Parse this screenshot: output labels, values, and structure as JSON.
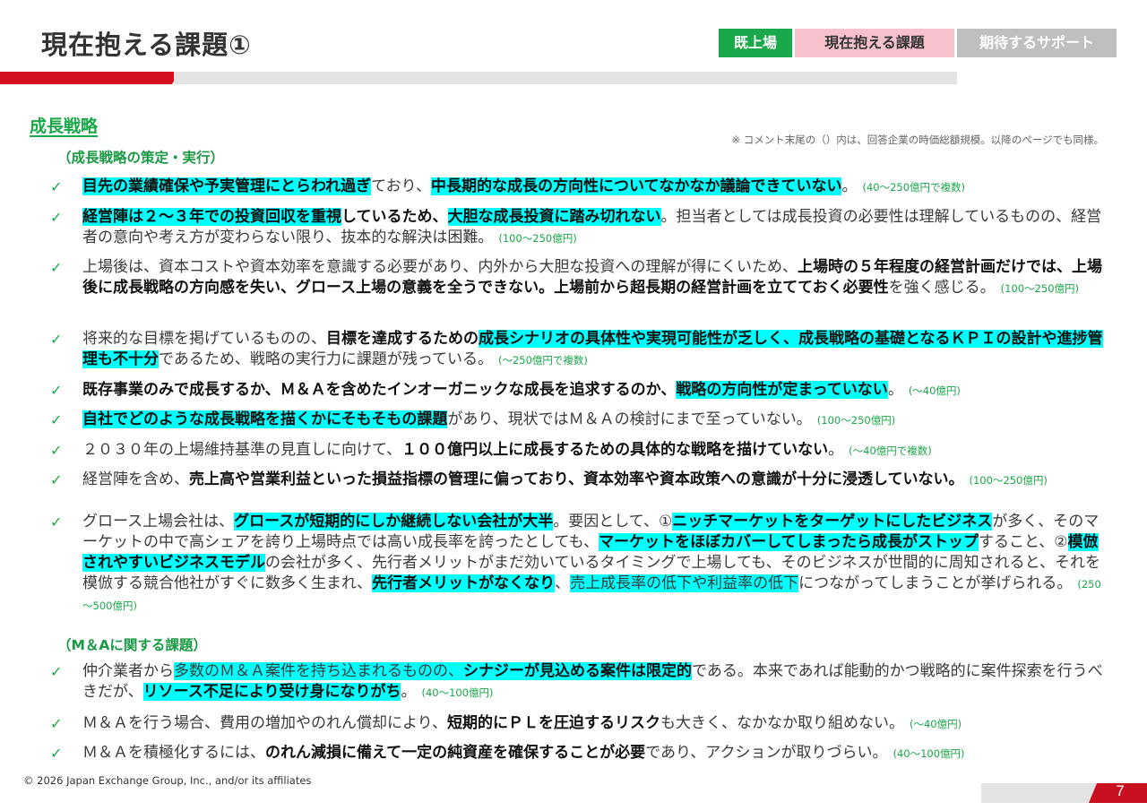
{
  "header": {
    "title": "現在抱える課題①",
    "tabs": [
      "既上場",
      "現在抱える課題",
      "期待するサポート"
    ]
  },
  "colors": {
    "accent_green": "#1aa84a",
    "accent_red": "#d2101e",
    "highlight": "#00ffff",
    "tab_active_pink": "#f7c1ce",
    "tab_inactive_gray": "#bfbfbf"
  },
  "section": {
    "title": "成長戦略",
    "note": "※ コメント末尾の（）内は、回答企業の時価総額規模。以降のページでも同様。"
  },
  "subsections": [
    "（成長戦略の策定・実行）",
    "（M＆Aに関する課題）"
  ],
  "check_mark": "✓",
  "items": [
    {
      "segs": [
        {
          "t": "目先の業績確保や予実管理にとらわれ過ぎ",
          "s": "bh"
        },
        {
          "t": "ており、",
          "s": "n"
        },
        {
          "t": "中長期的な成長の方向性についてなかなか議論できていない",
          "s": "bh"
        },
        {
          "t": "。",
          "s": "n"
        }
      ],
      "size": "(40～250億円で複数)"
    },
    {
      "segs": [
        {
          "t": "経営陣は２～３年での投資回収を重視",
          "s": "bh"
        },
        {
          "t": "しているため、",
          "s": "b"
        },
        {
          "t": "大胆な成長投資に踏み切れない",
          "s": "bh"
        },
        {
          "t": "。担当者としては成長投資の必要性は理解しているものの、経営者の意向や考え方が変わらない限り、抜本的な解決は困難。",
          "s": "n"
        }
      ],
      "size": "(100～250億円)"
    },
    {
      "segs": [
        {
          "t": "上場後は、資本コストや資本効率を意識する必要があり、内外から大胆な投資への理解が得にくいため、",
          "s": "n"
        },
        {
          "t": "上場時の５年程度の経営計画だけでは、上場後に成長戦略の方向感を失い、グロース上場の意義を全うできない。上場前から超長期の経営計画を立てておく必要性",
          "s": "b"
        },
        {
          "t": "を強く感じる。",
          "s": "n"
        }
      ],
      "size": "(100～250億円)"
    },
    {
      "segs": [
        {
          "t": "将来的な目標を掲げているものの、",
          "s": "n"
        },
        {
          "t": "目標を達成するための",
          "s": "b"
        },
        {
          "t": "成長シナリオの具体性や実現可能性が乏しく、成長戦略の基礎となるＫＰＩの設計や進捗管理も不十分",
          "s": "bh"
        },
        {
          "t": "であるため、戦略の実行力に課題が残っている。",
          "s": "n"
        }
      ],
      "size": "(～250億円で複数)"
    },
    {
      "segs": [
        {
          "t": "既存事業のみで成長するか、Ｍ＆Ａを含めたインオーガニックな成長を追求するのか、",
          "s": "b"
        },
        {
          "t": "戦略の方向性が定まっていない",
          "s": "bh"
        },
        {
          "t": "。",
          "s": "n"
        }
      ],
      "size": "(～40億円)"
    },
    {
      "segs": [
        {
          "t": "自社でどのような成長戦略を描くかにそもそもの課題",
          "s": "bh"
        },
        {
          "t": "があり、現状ではＭ＆Ａの検討にまで至っていない。",
          "s": "n"
        }
      ],
      "size": "(100～250億円)"
    },
    {
      "segs": [
        {
          "t": "２０３０年の上場維持基準の見直しに向けて、",
          "s": "n"
        },
        {
          "t": "１００億円以上に成長するための具体的な戦略を描けていない",
          "s": "b"
        },
        {
          "t": "。",
          "s": "n"
        }
      ],
      "size": "(～40億円で複数)"
    },
    {
      "segs": [
        {
          "t": "経営陣を含め、",
          "s": "n"
        },
        {
          "t": "売上高や営業利益といった損益指標の管理に偏っており、資本効率や資本政策への意識が十分に浸透していない。",
          "s": "b"
        }
      ],
      "size": "(100～250億円)"
    },
    {
      "segs": [
        {
          "t": "グロース上場会社は、",
          "s": "n"
        },
        {
          "t": "グロースが短期的にしか継続しない会社が大半",
          "s": "bh"
        },
        {
          "t": "。要因として、①",
          "s": "n"
        },
        {
          "t": "ニッチマーケットをターゲットにしたビジネス",
          "s": "bh"
        },
        {
          "t": "が多く、そのマーケットの中で高シェアを誇り上場時点では高い成長率を誇ったとしても、",
          "s": "n"
        },
        {
          "t": "マーケットをほぼカバーしてしまったら成長がストップ",
          "s": "bh"
        },
        {
          "t": "すること、②",
          "s": "n"
        },
        {
          "t": "模倣されやすいビジネスモデル",
          "s": "bh"
        },
        {
          "t": "の会社が多く、先行者メリットがまだ効いているタイミングで上場しても、そのビジネスが世間的に周知されると、それを模倣する競合他社がすぐに数多く生まれ、",
          "s": "n"
        },
        {
          "t": "先行者メリットがなくなり",
          "s": "bh"
        },
        {
          "t": "、",
          "s": "n"
        },
        {
          "t": "売上成長率の低下や利益率の低下",
          "s": "h"
        },
        {
          "t": "につながってしまうことが挙げられる。",
          "s": "n"
        }
      ],
      "size": "(250～500億円)"
    },
    {
      "segs": [
        {
          "t": "仲介業者から",
          "s": "n"
        },
        {
          "t": "多数のＭ＆Ａ案件を持ち込まれるものの、",
          "s": "h"
        },
        {
          "t": "シナジーが見込める案件は限定的",
          "s": "bh"
        },
        {
          "t": "である。本来であれば能動的かつ戦略的に案件探索を行うべきだが、",
          "s": "n"
        },
        {
          "t": "リソース不足により受け身になりがち",
          "s": "bh"
        },
        {
          "t": "。",
          "s": "n"
        }
      ],
      "size": "(40～100億円)"
    },
    {
      "segs": [
        {
          "t": "Ｍ＆Ａを行う場合、費用の増加やのれん償却により、",
          "s": "n"
        },
        {
          "t": "短期的にＰＬを圧迫するリスク",
          "s": "b"
        },
        {
          "t": "も大きく、なかなか取り組めない。",
          "s": "n"
        }
      ],
      "size": "(～40億円)"
    },
    {
      "segs": [
        {
          "t": "Ｍ＆Ａを積極化するには、",
          "s": "n"
        },
        {
          "t": "のれん減損に備えて一定の純資産を確保することが必要",
          "s": "b"
        },
        {
          "t": "であり、アクションが取りづらい。",
          "s": "n"
        }
      ],
      "size": "(40～100億円)"
    }
  ],
  "footer": {
    "copyright": "© 2026 Japan Exchange Group, Inc., and/or its affiliates",
    "page": "7"
  }
}
